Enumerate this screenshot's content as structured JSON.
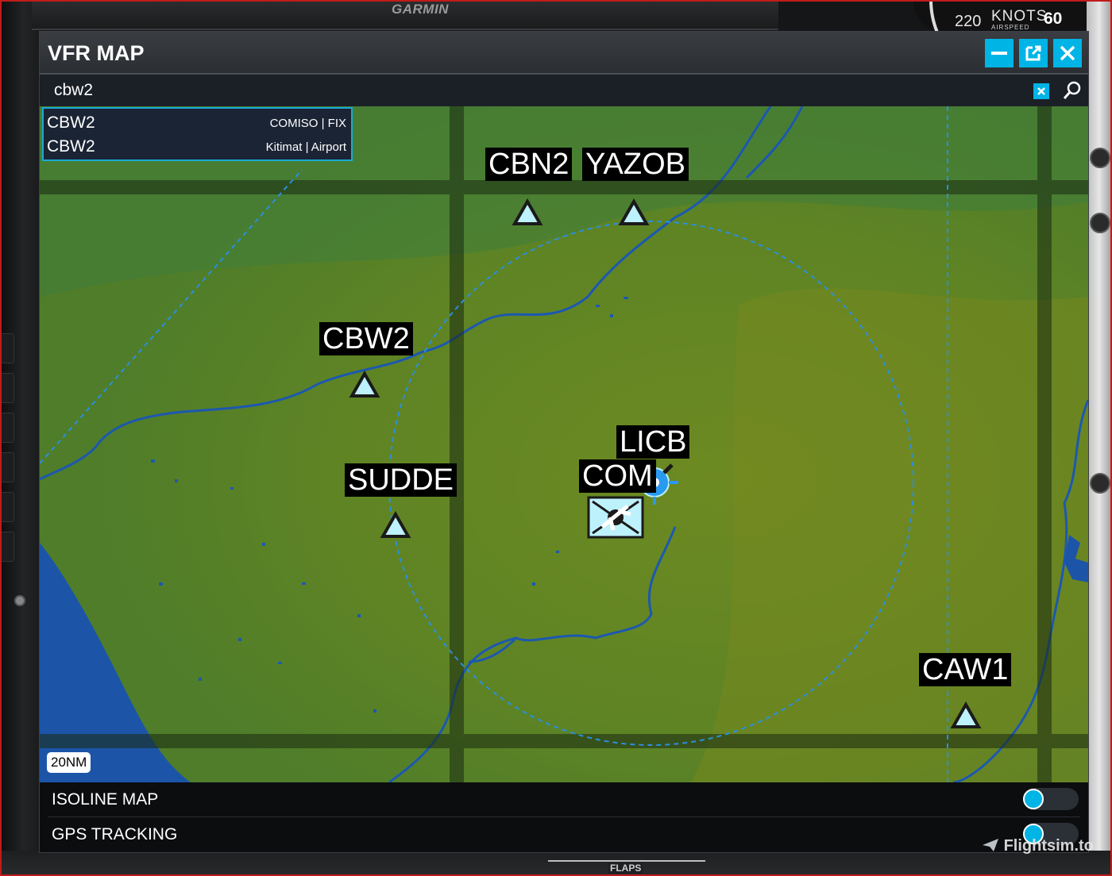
{
  "cockpit": {
    "brand": "GARMIN",
    "airspeed": {
      "mark_220": "220",
      "knots": "KNOTS",
      "airspeed": "AIRSPEED",
      "mark_60": "60"
    },
    "flaps": "FLAPS",
    "watermark": "Flightsim.to"
  },
  "window": {
    "title": "VFR MAP",
    "buttons": {
      "minimize": "minimize-icon",
      "popout": "popout-icon",
      "close": "close-icon"
    }
  },
  "search": {
    "value": "cbw2",
    "clear_icon": "close-icon",
    "search_icon": "search-icon"
  },
  "results": [
    {
      "code": "CBW2",
      "detail": "COMISO | FIX"
    },
    {
      "code": "CBW2",
      "detail": "Kitimat | Airport"
    }
  ],
  "map": {
    "scale": "20NM",
    "waypoints": [
      {
        "id": "cbn2",
        "label": "CBN2",
        "type": "fix"
      },
      {
        "id": "yazob",
        "label": "YAZOB",
        "type": "fix"
      },
      {
        "id": "cbw2",
        "label": "CBW2",
        "type": "fix"
      },
      {
        "id": "sudde",
        "label": "SUDDE",
        "type": "fix"
      },
      {
        "id": "licb",
        "label": "LICB",
        "type": "airport"
      },
      {
        "id": "com",
        "label": "COM",
        "type": "vor"
      },
      {
        "id": "caw1",
        "label": "CAW1",
        "type": "fix"
      }
    ],
    "colors": {
      "land": "#527f27",
      "water": "#1c55a7",
      "route": "#2a8fe0",
      "fix_fill": "#bdf1fb"
    }
  },
  "options": [
    {
      "label": "ISOLINE MAP",
      "enabled": false
    },
    {
      "label": "GPS TRACKING",
      "enabled": false
    }
  ]
}
